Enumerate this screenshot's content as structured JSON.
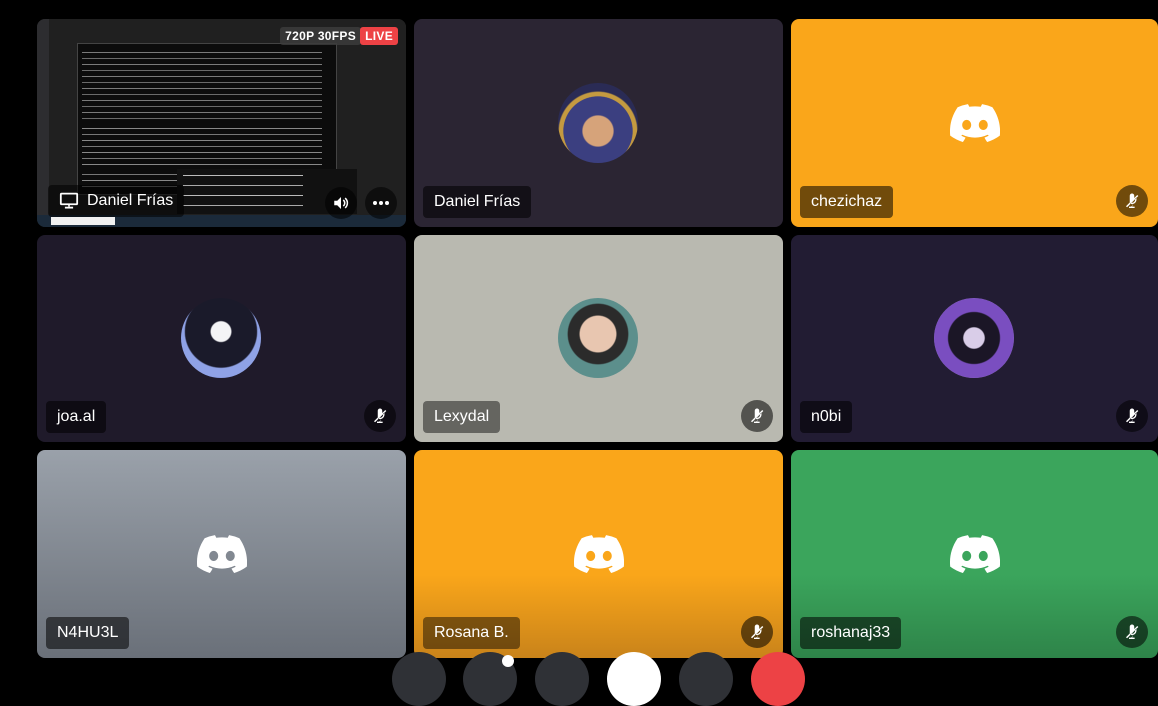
{
  "stream": {
    "quality_badge": "720P 30FPS",
    "live_badge": "LIVE",
    "streamer_name": "Daniel Frías"
  },
  "participants": [
    {
      "name": "Daniel Frías"
    },
    {
      "name": "chezichaz"
    },
    {
      "name": "joa.al"
    },
    {
      "name": "Lexydal"
    },
    {
      "name": "n0bi"
    },
    {
      "name": "N4HU3L"
    },
    {
      "name": "Rosana B."
    },
    {
      "name": "roshanaj33"
    }
  ],
  "colors": {
    "orange": "#faa61a",
    "green": "#3ba55c",
    "dark_tile": "#2b2533",
    "dark_tile_alt": "#1f1a2a",
    "gray_tile": "#b9b9b0",
    "live_red": "#ed4245"
  },
  "icons": [
    "monitor-icon",
    "volume-icon",
    "more-options-icon",
    "muted-mic-icon",
    "discord-logo-icon"
  ]
}
